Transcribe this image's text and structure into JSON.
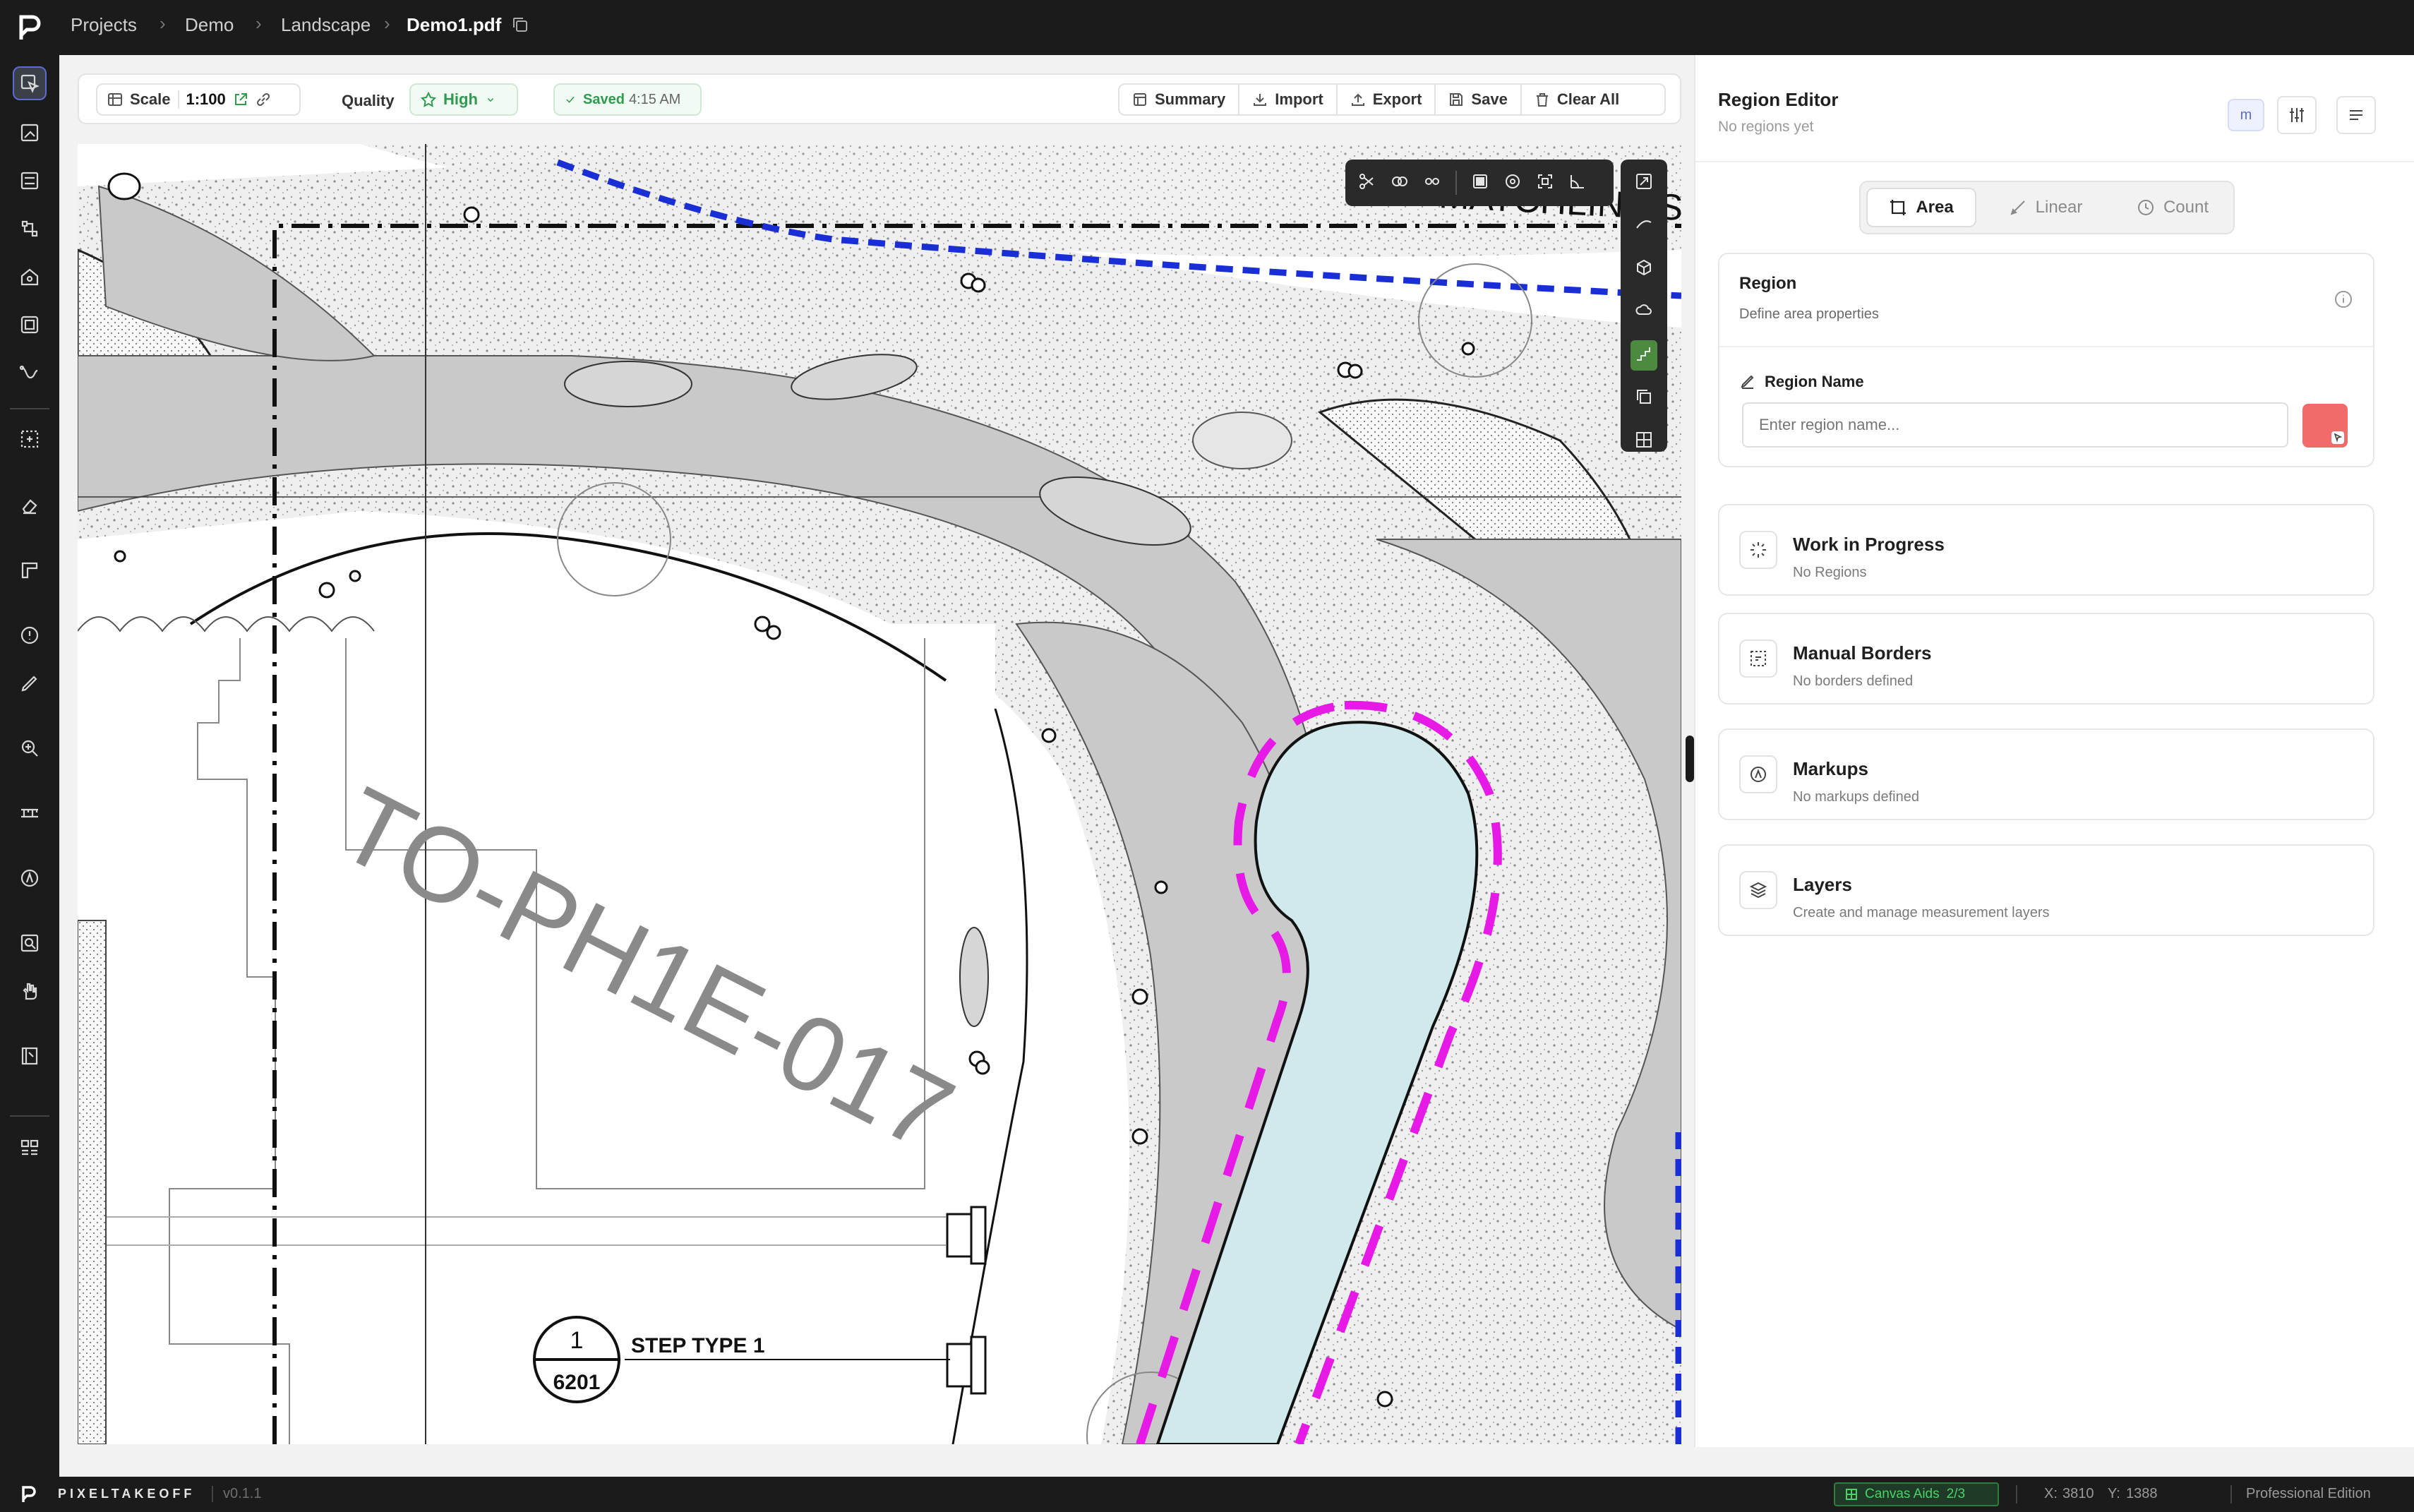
{
  "breadcrumb": {
    "items": [
      "Projects",
      "Demo",
      "Landscape"
    ],
    "file": "Demo1.pdf"
  },
  "toolbar": {
    "scale_label": "Scale",
    "scale_value": "1:100",
    "quality_label": "Quality",
    "quality_value": "High",
    "saved_label": "Saved",
    "saved_time": "4:15 AM",
    "summary": "Summary",
    "import": "Import",
    "export": "Export",
    "save": "Save",
    "clear_all": "Clear All"
  },
  "drawing": {
    "watermark": "TO-PH1E-017",
    "matchline": "MATCHLINE SH",
    "callout_top": "1",
    "callout_bottom": "6201",
    "callout_label": "STEP TYPE 1"
  },
  "panel": {
    "title": "Region Editor",
    "subtitle": "No regions yet",
    "unit_badge": "m",
    "tabs": [
      "Area",
      "Linear",
      "Count"
    ],
    "active_tab": "Area",
    "region": {
      "title": "Region",
      "subtitle": "Define area properties",
      "name_label": "Region Name",
      "name_placeholder": "Enter region name...",
      "color": "#f26b6b"
    },
    "sections": [
      {
        "title": "Work in Progress",
        "subtitle": "No Regions",
        "icon": "loader-icon"
      },
      {
        "title": "Manual Borders",
        "subtitle": "No borders defined",
        "icon": "border-icon"
      },
      {
        "title": "Markups",
        "subtitle": "No markups defined",
        "icon": "markup-icon"
      },
      {
        "title": "Layers",
        "subtitle": "Create and manage measurement layers",
        "icon": "layers-icon"
      }
    ]
  },
  "status": {
    "brand": "PIXELTAKEOFF",
    "version": "v0.1.1",
    "canvas_aids": "Canvas Aids",
    "canvas_aids_count": "2/3",
    "x_label": "X:",
    "x_value": "3810",
    "y_label": "Y:",
    "y_value": "1388",
    "edition": "Professional Edition"
  },
  "colors": {
    "accent": "#5b6bd6",
    "saved": "#2e9b4f",
    "pool": "#cfe9ec",
    "outline": "#e619e6",
    "boundary": "#1a2ed6"
  }
}
